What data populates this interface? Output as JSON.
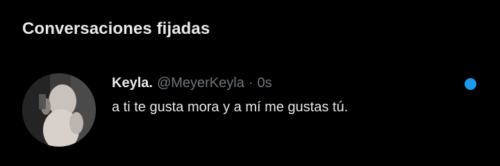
{
  "section": {
    "title": "Conversaciones fijadas"
  },
  "conversation": {
    "display_name": "Keyla.",
    "handle": "@MeyerKeyla",
    "separator": "·",
    "time": "0s",
    "message": "a ti te gusta mora y a mí me gustas tú.",
    "unread": true
  },
  "colors": {
    "background": "#000000",
    "primary_text": "#e7e9ea",
    "secondary_text": "#71767b",
    "accent": "#1d9bf0"
  }
}
